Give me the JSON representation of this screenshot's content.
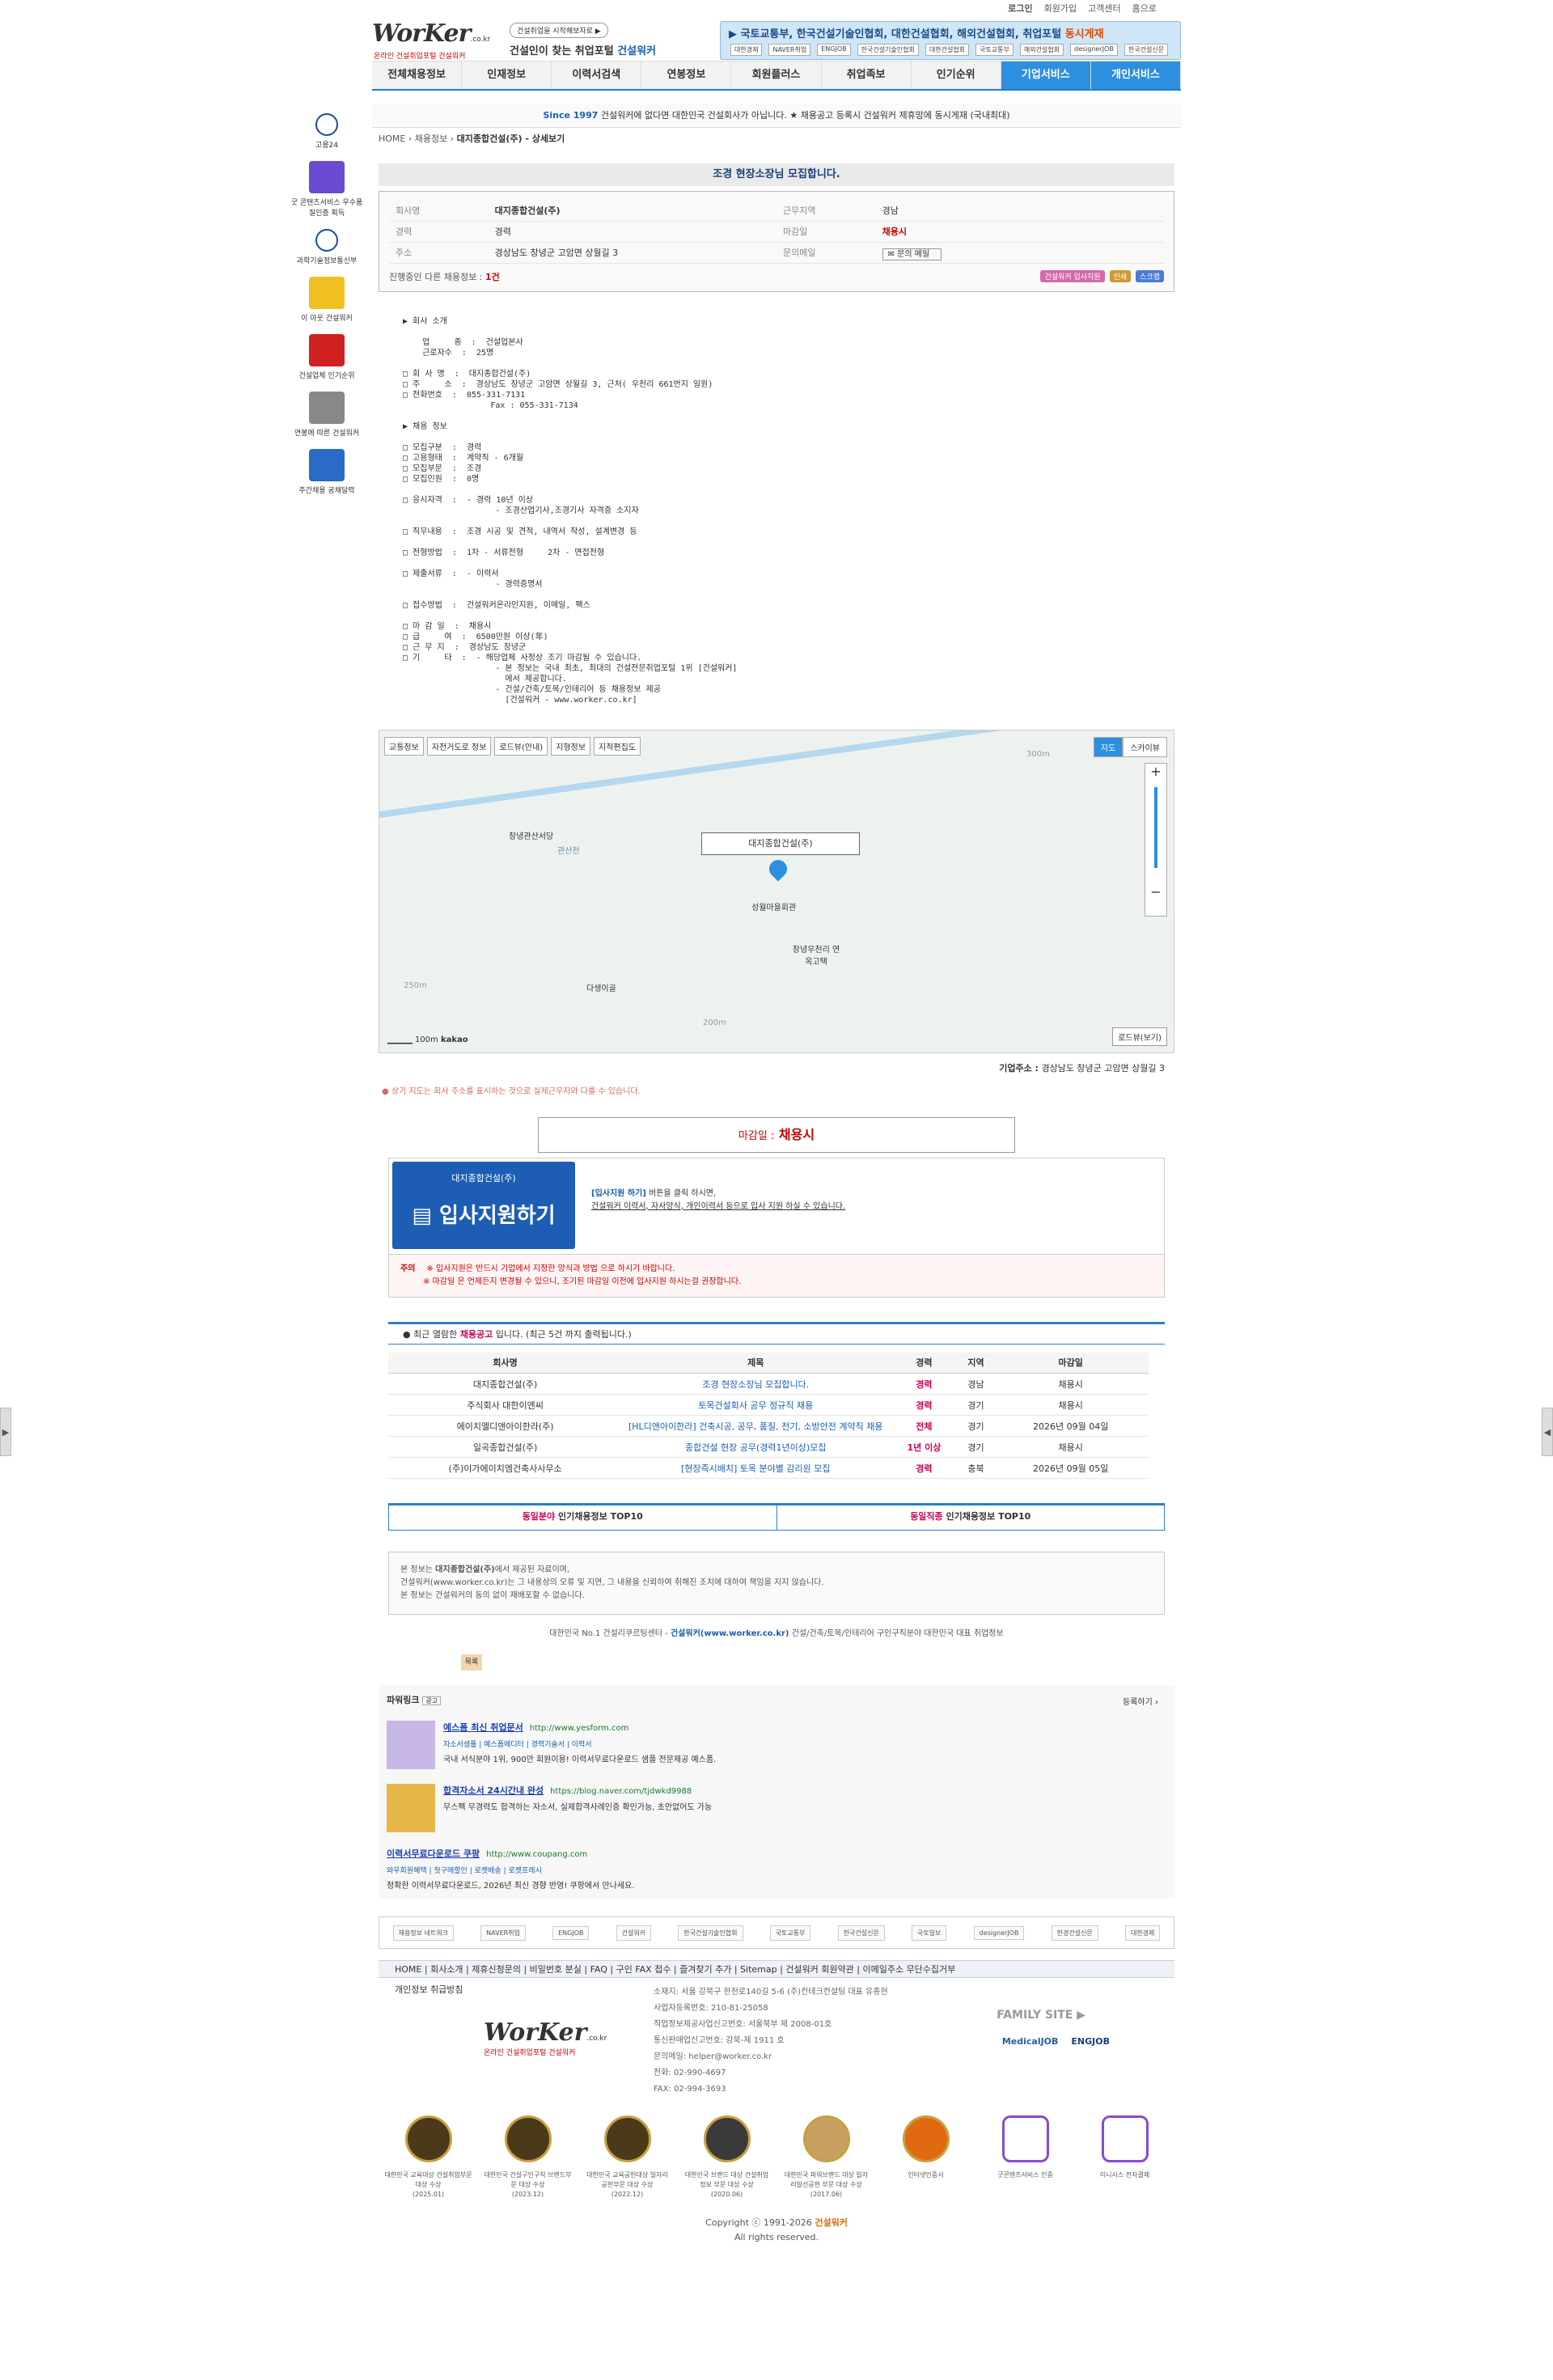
{
  "util": {
    "login": "로그인",
    "join": "회원가입",
    "cs": "고객센터",
    "start": "홈으로"
  },
  "header": {
    "logo": "WorKer",
    "logo_tld": ".co.kr",
    "logo_sub": "온라인 건설취업포털 건설워커",
    "badge": "건설취업을 시작해보자로 ▶",
    "slogan_pre": "건설인이 찾는 취업포털",
    "slogan_brand": "건설워커",
    "banner_text": "▶ 국토교통부, 한국건설기술인협회, 대한건설협회, 해외건설협회, 취업포털",
    "banner_em": "동시게재",
    "banner_logos": [
      "대한경제",
      "NAVER취업",
      "ENGJOB",
      "한국건설기술인협회",
      "대한건설협회",
      "국토교통부",
      "해외건설협회",
      "designerJOB",
      "한국건설신문"
    ]
  },
  "nav": [
    "전체채용정보",
    "인재정보",
    "이력서검색",
    "연봉정보",
    "회원플러스",
    "취업족보",
    "인기순위",
    "기업서비스",
    "개인서비스"
  ],
  "notice": {
    "since": "Since 1997",
    "text": "건설워커에 없다면 대한민국 건설회사가 아닙니다. ★ 채용공고 등록시 건설워커 제휴망에 동시게재 (국내최대)"
  },
  "breadcrumb": {
    "home": "HOME",
    "cat": "채용정보",
    "current": "대지종합건설(주) - 상세보기"
  },
  "left": [
    {
      "label": "고용24"
    },
    {
      "label": "굿 콘텐츠서비스 우수품질인증 획득"
    },
    {
      "label": "과학기술정보통신부"
    },
    {
      "label": "이 아웃 건설워커"
    },
    {
      "label": "건설업체 인기순위"
    },
    {
      "label": "연봉에 따른 건설워커"
    },
    {
      "label": "주간채용 공채달력"
    }
  ],
  "job": {
    "title": "조경 현장소장님 모집합니다.",
    "company_k": "회사명",
    "company": "대지종합건설(주)",
    "region_k": "근무지역",
    "region": "경남",
    "career_k": "경력",
    "career": "경력",
    "deadline_k": "마감일",
    "deadline": "채용시",
    "address_k": "주소",
    "address": "경상남도 창녕군 고암면 상월길 3",
    "contact_k": "문의메일",
    "contact": "문의 메일",
    "ongoing": "진행중인 다른 채용정보 :",
    "ongoing_n": "1건",
    "minis": [
      "건설워커 입사지원",
      "인쇄",
      "스크랩"
    ]
  },
  "desc": "▶ 회사 소개\n\n    업     종  :  건설업본사\n    근로자수  :  25명\n\n□ 회 사 명  :  대지종합건설(주)\n□ 주     소  :  경상남도 창녕군 고암면 상월길 3, 근처( 우천리 661번지 일원)\n□ 전화번호  :  055-331-7131\n                  Fax : 055-331-7134\n\n▶ 채용 정보\n\n□ 모집구분  :  경력\n□ 고용형태  :  계약직 - 6개월\n□ 모집부문  :  조경\n□ 모집인원  :  0명\n\n□ 응시자격  :  - 경력 10년 이상\n                   - 조경산업기사,조경기사 자격증 소지자\n\n□ 직무내용  :  조경 시공 및 견적, 내역서 작성, 설계변경 등\n\n□ 전형방법  :  1차 - 서류전형     2차 - 면접전형\n\n□ 제출서류  :  - 이력서\n                   - 경력증명서\n\n□ 접수방법  :  건설워커온라인지원, 이메일, 팩스\n\n□ 마 감 일  :  채용시\n□ 급     여  :  6500만원 이상(年)\n□ 근 무 지  :  경상남도 창녕군\n□ 기     타  :  - 해당업체 사정상 조기 마감될 수 있습니다.\n                   - 본 정보는 국내 최초, 최대의 건설전문취업포털 1위 [건설워커]\n                     에서 제공합니다.\n                   - 건설/건축/토목/인테리어 등 채용정보 제공\n                     [건설워커 - www.worker.co.kr]",
  "map": {
    "buttons": [
      "교통정보",
      "자전거도로 정보",
      "로드뷰(안내)",
      "지형정보",
      "지적편집도"
    ],
    "type_map": "지도",
    "type_sky": "스카이뷰",
    "callout": "대지종합건설(주)",
    "labels": [
      "창녕관산서당",
      "성월마을회관",
      "창녕우천리 연옥고택",
      "다생이골",
      "300m",
      "250m",
      "200m",
      "관산천"
    ],
    "roadview": "로드뷰(보기)",
    "scale": "100m",
    "brand": "kakao"
  },
  "addr": {
    "k": "기업주소 :",
    "v": "경상남도 창녕군 고암면 상월길 3"
  },
  "mapnote": "상기 지도는 회사 주소를 표시하는 것으로 실제근무지와 다를 수 있습니다.",
  "deadline": {
    "label": "마감일 :",
    "value": "채용시"
  },
  "apply": {
    "company": "대지종합건설(주)",
    "btn": "입사지원하기",
    "line1_b": "[입사지원 하기]",
    "line1": " 버튼을 클릭 하시면,",
    "line2": "건설워커 이력서, 자사양식, 개인이력서 등으로 입사 지원 하실 수 있습니다.",
    "warn_k": "주의",
    "warn1": "※ 입사지원은 반드시 기업에서 지정한 양식과 방법 으로 하시기 바랍니다.",
    "warn2": "※ 마감일 은 언제든지 변경될 수 있으니, 조기된 마감일 이전에 입사지원 하시는걸 권장합니다."
  },
  "recent": {
    "pre": "최근 열람한",
    "em": "채용공고",
    "post": "입니다.    (최근 5건 까지 출력됩니다.)",
    "cols": [
      "회사명",
      "제목",
      "경력",
      "지역",
      "마감일"
    ],
    "rows": [
      [
        "대지종합건설(주)",
        "조경 현장소장님 모집합니다.",
        "경력",
        "경남",
        "채용시"
      ],
      [
        "주식회사 대한이엔씨",
        "토목건설회사 공무 정규직 채용",
        "경력",
        "경기",
        "채용시"
      ],
      [
        "에이치엘디앤아이한라(주)",
        "[HL디앤아이한라] 건축시공, 공무, 품질, 전기, 소방안전 계약직 채용",
        "전체",
        "경기",
        "2026년 09월 04일"
      ],
      [
        "일곡종합건설(주)",
        "종합건설 현장 공무(경력1년이상)모집",
        "1년 이상",
        "경기",
        "채용시"
      ],
      [
        "(주)이가에이치엠건축사사무소",
        "[현장즉시배치] 토목 분야별 감리원 모집",
        "경력",
        "충북",
        "2026년 09월 05일"
      ]
    ]
  },
  "top10": {
    "a_r": "동일분야",
    "a": "인기채용정보 TOP10",
    "b_r": "동일직종",
    "b": "인기채용정보 TOP10"
  },
  "disclaim": {
    "l1_pre": "본 정보는",
    "l1_b": "대지종합건설(주)",
    "l1_post": "에서 제공된 자료이며,",
    "l2": "건설워커(www.worker.co.kr)는 그 내용상의 오류 및 지연, 그 내용을 신뢰하여 취해진 조치에 대하여 책임을 지지 않습니다.",
    "l3": "본 정보는 건설워커의 동의 없이 재배포할 수 없습니다."
  },
  "slogan": {
    "pre": "대한민국 No.1 건설리쿠르팅센터 -",
    "b": "건설워커(www.worker.co.kr)",
    "post": "건설/건축/토목/인테리어 구인구직분야 대한민국 대표 취업정보"
  },
  "listbtn": "목록",
  "power": {
    "title": "파워링크",
    "ad": "광고",
    "reg": "등록하기 ›",
    "items": [
      {
        "title": "예스폼 최신 취업문서",
        "url": "http://www.yesform.com",
        "sub": "자소서샘플 | 예스폼에디터 | 경력기술서 | 이력서",
        "desc": "국내 서식분야 1위, 900만 회원이용! 이력서무료다운로드 샘플 전문제공 예스폼."
      },
      {
        "title": "합격자소서 24시간내 완성",
        "url": "https://blog.naver.com/tjdwkd9988",
        "sub": "",
        "desc": "무스펙 무경력도 합격하는 자소서, 실제합격사례인증 확인가능, 초안없어도 가능"
      },
      {
        "title": "이력서무료다운로드 쿠팡",
        "url": "http://www.coupang.com",
        "sub": "와우회원혜택 | 첫구매할인 | 로켓배송 | 로켓프레시",
        "desc": "정확한 이력서무료다운로드, 2026년 최신 경향 반영! 쿠팡에서 만나세요."
      }
    ]
  },
  "partners": [
    "채용정보 네트워크",
    "NAVER취업",
    "ENGJOB",
    "건설워커",
    "한국건설기술인협회",
    "국토교통부",
    "한국건설신문",
    "국토일보",
    "designerJOB",
    "한경건설신문",
    "대한경제"
  ],
  "flinks": "HOME | 회사소개 | 제휴신청문의 | 비밀번호 분실 | FAQ | 구인 FAX 접수 | 즐겨찾기 추가 | Sitemap | 건설워커 회원약관 | 이메일주소 무단수집거부",
  "footer": {
    "privacy": "개인정보 취급방침",
    "info": [
      "소재지: 서울 강북구 한천로140길 5-6 (주)컨테크컨설팅 대표 유종현",
      "사업자등록번호: 210-81-25058",
      "직업정보제공사업신고번호: 서울북부 제 2008-01호",
      "통신판매업신고번호: 강북-제 1911 호",
      "문의메일: helper@worker.co.kr",
      "전화: 02-990-4697",
      "FAX: 02-994-3693"
    ],
    "family": "FAMILY SITE ▶",
    "family_links": [
      "MedicalJOB",
      "ENGJOB"
    ]
  },
  "awards": [
    {
      "t": "대한민국 교육대상 건설취업부문 대상 수상",
      "d": "(2025.01)"
    },
    {
      "t": "대한민국 건설구인구직 브랜드부문 대상 수상",
      "d": "(2023.12)"
    },
    {
      "t": "대한민국 교육공헌대상 일자리 공헌부문 대상 수상",
      "d": "(2022.12)"
    },
    {
      "t": "대한민국 브랜드 대상 건설취업정보 부문 대상 수상",
      "d": "(2020.06)"
    },
    {
      "t": "대한민국 파워브랜드 대상 일자리알선공헌 부문 대상 수상",
      "d": "(2017.06)"
    },
    {
      "t": "인터넷인증서",
      "d": ""
    },
    {
      "t": "굿콘텐츠서비스 인증",
      "d": ""
    },
    {
      "t": "이니시스 전자결제",
      "d": ""
    }
  ],
  "copy": {
    "pre": "Copyright ⓒ 1991-2026",
    "brand": "건설워커",
    "rights": "All rights reserved."
  },
  "colors": {
    "primary": "#2d8fe0",
    "accent": "#c00"
  }
}
